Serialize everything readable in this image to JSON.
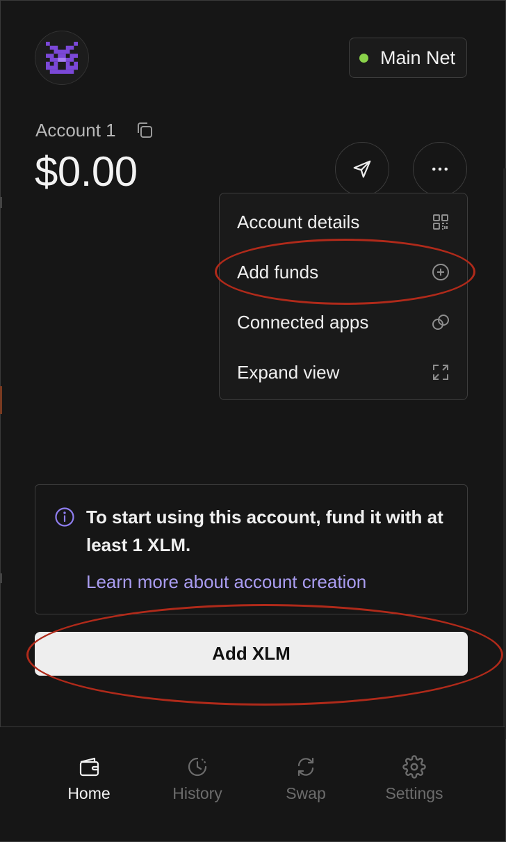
{
  "header": {
    "avatar_icon": "identicon-icon",
    "network": {
      "label": "Main Net",
      "status_color": "#8ad24a"
    }
  },
  "account": {
    "name": "Account 1",
    "balance": "$0.00"
  },
  "actions": {
    "send_icon": "send-icon",
    "more_icon": "more-icon"
  },
  "menu": {
    "items": [
      {
        "label": "Account details",
        "icon": "qr-code-icon"
      },
      {
        "label": "Add funds",
        "icon": "plus-circle-icon"
      },
      {
        "label": "Connected apps",
        "icon": "link-circles-icon"
      },
      {
        "label": "Expand view",
        "icon": "expand-icon"
      }
    ]
  },
  "notice": {
    "text": "To start using this account, fund it with at least 1 XLM.",
    "link": "Learn more about account creation",
    "link_color": "#a99cf0"
  },
  "primary_button": {
    "label": "Add XLM"
  },
  "nav": {
    "items": [
      {
        "label": "Home",
        "icon": "wallet-icon",
        "active": true
      },
      {
        "label": "History",
        "icon": "history-icon",
        "active": false
      },
      {
        "label": "Swap",
        "icon": "swap-icon",
        "active": false
      },
      {
        "label": "Settings",
        "icon": "gear-icon",
        "active": false
      }
    ]
  },
  "colors": {
    "background": "#161616",
    "accent": "#a99cf0",
    "annotation": "#b02a1a"
  }
}
